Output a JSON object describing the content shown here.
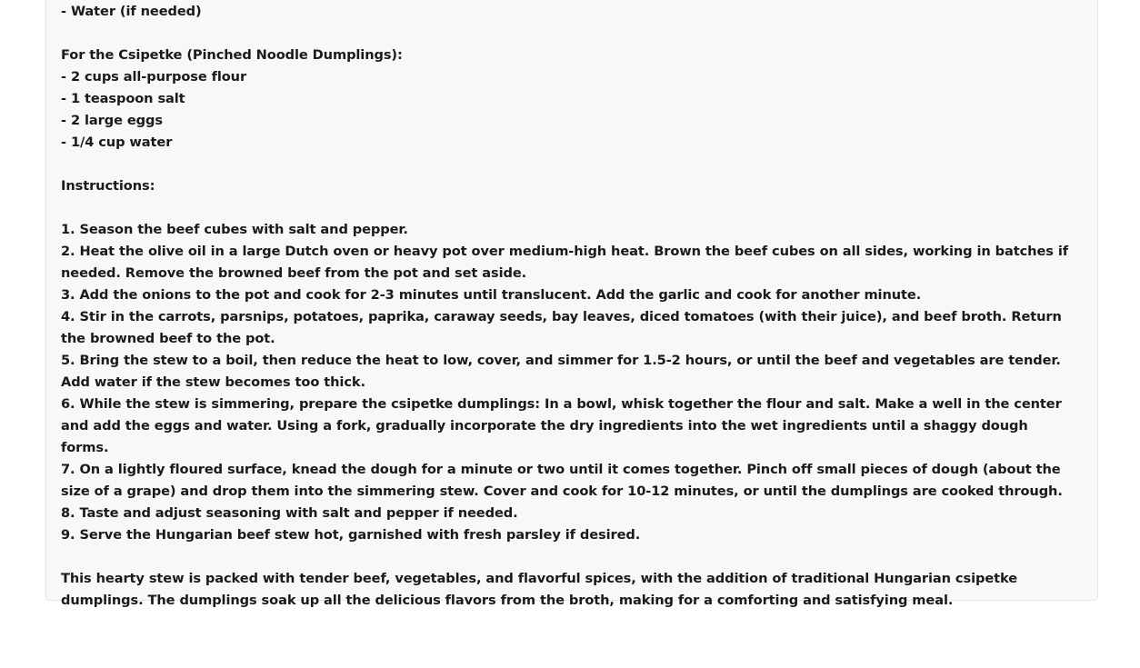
{
  "ingredients_tail": "- Water (if needed)",
  "csipetke": {
    "heading": "For the Csipetke (Pinched Noodle Dumplings):",
    "items": [
      "- 2 cups all-purpose flour",
      "- 1 teaspoon salt",
      "- 2 large eggs",
      "- 1/4 cup water"
    ]
  },
  "instructions": {
    "heading": "Instructions:",
    "steps": [
      "1. Season the beef cubes with salt and pepper.",
      "2. Heat the olive oil in a large Dutch oven or heavy pot over medium-high heat. Brown the beef cubes on all sides, working in batches if needed. Remove the browned beef from the pot and set aside.",
      "3. Add the onions to the pot and cook for 2-3 minutes until translucent. Add the garlic and cook for another minute.",
      "4. Stir in the carrots, parsnips, potatoes, paprika, caraway seeds, bay leaves, diced tomatoes (with their juice), and beef broth. Return the browned beef to the pot.",
      "5. Bring the stew to a boil, then reduce the heat to low, cover, and simmer for 1.5-2 hours, or until the beef and vegetables are tender. Add water if the stew becomes too thick.",
      "6. While the stew is simmering, prepare the csipetke dumplings: In a bowl, whisk together the flour and salt. Make a well in the center and add the eggs and water. Using a fork, gradually incorporate the dry ingredients into the wet ingredients until a shaggy dough forms.",
      "7. On a lightly floured surface, knead the dough for a minute or two until it comes together. Pinch off small pieces of dough (about the size of a grape) and drop them into the simmering stew. Cover and cook for 10-12 minutes, or until the dumplings are cooked through.",
      "8. Taste and adjust seasoning with salt and pepper if needed.",
      "9. Serve the Hungarian beef stew hot, garnished with fresh parsley if desired."
    ]
  },
  "closing": "This hearty stew is packed with tender beef, vegetables, and flavorful spices, with the addition of traditional Hungarian csipetke dumplings. The dumplings soak up all the delicious flavors from the broth, making for a comforting and satisfying meal."
}
